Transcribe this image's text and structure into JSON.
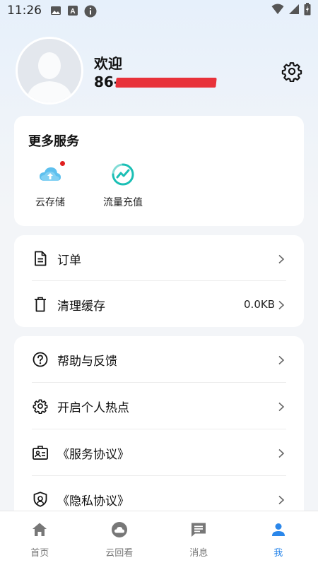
{
  "status_bar": {
    "time": "11:26"
  },
  "profile": {
    "welcome": "欢迎",
    "phone_prefix": "86-"
  },
  "services": {
    "title": "更多服务",
    "items": [
      {
        "label": "云存储",
        "icon": "cloud-storage-icon",
        "badge": true
      },
      {
        "label": "流量充值",
        "icon": "data-recharge-icon",
        "badge": false
      }
    ]
  },
  "menu1": [
    {
      "label": "订单",
      "icon": "document-icon"
    },
    {
      "label": "清理缓存",
      "icon": "trash-icon",
      "value": "0.0KB"
    }
  ],
  "menu2": [
    {
      "label": "帮助与反馈",
      "icon": "help-icon"
    },
    {
      "label": "开启个人热点",
      "icon": "gear-icon"
    },
    {
      "label": "《服务协议》",
      "icon": "id-card-icon"
    },
    {
      "label": "《隐私协议》",
      "icon": "shield-icon"
    }
  ],
  "tabbar": [
    {
      "label": "首页",
      "icon": "home-icon",
      "active": false
    },
    {
      "label": "云回看",
      "icon": "cloud-playback-icon",
      "active": false
    },
    {
      "label": "消息",
      "icon": "message-icon",
      "active": false
    },
    {
      "label": "我",
      "icon": "person-icon",
      "active": true
    }
  ],
  "colors": {
    "accent": "#2b87ea",
    "badge": "#e02020",
    "background": "#f3f5f8"
  }
}
